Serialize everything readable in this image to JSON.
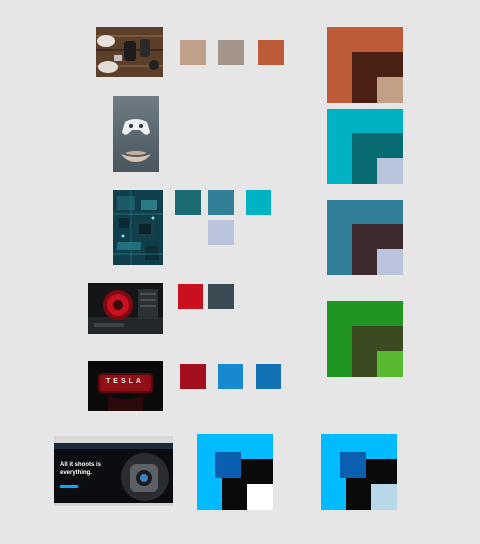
{
  "rows": [
    {
      "photo": "photo-hands-game-controllers-on-wood",
      "swatches": [
        "#c0a08a",
        "#a4958a",
        "#bd5b38"
      ],
      "palette_block": [
        "#bd5b38",
        "#4a2114",
        "#c1a087"
      ]
    },
    {
      "photo": "photo-floating-game-controller",
      "swatches": [],
      "palette_block": [
        "#00b3c4",
        "#086b73",
        "#b8c4dc"
      ]
    },
    {
      "photo": "photo-teal-circuit-board",
      "swatches": [
        "#1b6d73",
        "#327f99",
        "#00b3c4",
        "#b9c3dc"
      ],
      "palette_block": [
        "#327f99",
        "#3d2a2e",
        "#b9c3dc"
      ]
    },
    {
      "photo": "photo-red-cpu-cooler",
      "swatches": [
        "#c8101f",
        "#3a4a52"
      ],
      "palette_block": [
        "#1e9621",
        "#3c4a22",
        "#58b830"
      ]
    },
    {
      "photo": "photo-tesla-sign",
      "swatches": [
        "#a30f1c",
        "#1888d0",
        "#1272b3"
      ],
      "palette_block": null
    },
    {
      "photo": "screenshot-camera-website",
      "swatches": [],
      "palette_blocks": [
        [
          "#00bbff",
          "#0a0a0a",
          "#ffffff",
          "#0b5fb0"
        ],
        [
          "#00bbff",
          "#0a0a0a",
          "#b8d8ea",
          "#0b5fb0"
        ]
      ]
    }
  ],
  "tesla": {
    "logo_text": "TESLA"
  },
  "website": {
    "headline_1": "All it shoots is",
    "headline_2": "everything."
  }
}
